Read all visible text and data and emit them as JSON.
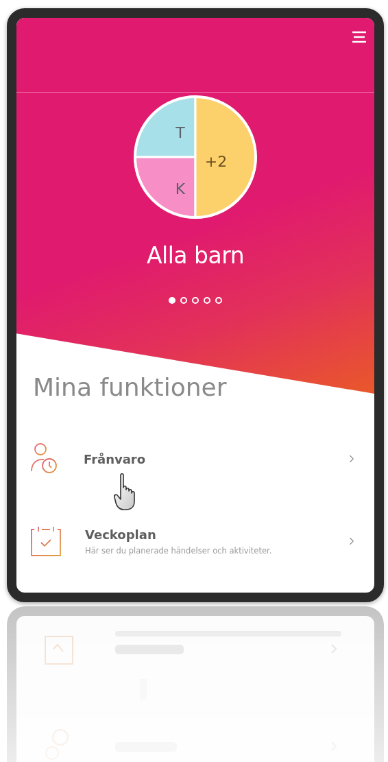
{
  "profile": {
    "avatar_segments": [
      {
        "label": "T",
        "color": "#a8e0ea"
      },
      {
        "label": "K",
        "color": "#f78fc6"
      },
      {
        "label": "+2",
        "color": "#fcd16b"
      }
    ],
    "name": "Alla barn"
  },
  "pager": [
    {
      "selected": true
    },
    {
      "selected": false
    },
    {
      "selected": false
    },
    {
      "selected": false
    },
    {
      "selected": false
    }
  ],
  "section_title": "Mina funktioner",
  "functions": [
    {
      "kind": "absence",
      "title": "Frånvaro"
    },
    {
      "kind": "calendar",
      "title": "Veckoplan",
      "subtitle": "Här ser du planerade händelser och aktiviteter."
    }
  ]
}
